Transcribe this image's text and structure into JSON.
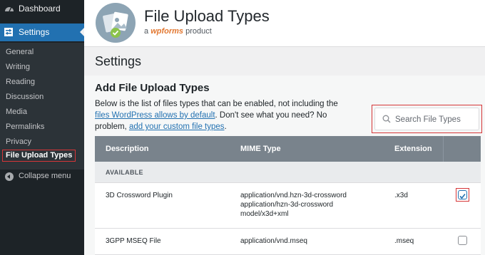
{
  "sidebar": {
    "dashboard_label": "Dashboard",
    "settings_label": "Settings",
    "submenu": [
      "General",
      "Writing",
      "Reading",
      "Discussion",
      "Media",
      "Permalinks",
      "Privacy",
      "File Upload Types"
    ],
    "collapse_label": "Collapse menu"
  },
  "header": {
    "title": "File Upload Types",
    "byline_prefix": "a",
    "brand": "wpforms",
    "byline_suffix": "product"
  },
  "page": {
    "title": "Settings"
  },
  "section": {
    "title": "Add File Upload Types",
    "desc_1": "Below is the list of files types that can be enabled, not including the ",
    "link_1": "files WordPress allows by default",
    "desc_2": ". Don't see what you need? No problem, ",
    "link_2": "add your custom file types",
    "desc_3": "."
  },
  "search": {
    "placeholder": "Search File Types"
  },
  "table": {
    "headers": [
      "Description",
      "MIME Type",
      "Extension"
    ],
    "group_label": "AVAILABLE",
    "rows": [
      {
        "description": "3D Crossword Plugin",
        "mime_1": "application/vnd.hzn-3d-crossword",
        "mime_2": "application/hzn-3d-crossword",
        "mime_3": "model/x3d+xml",
        "extension": ".x3d",
        "checked": true
      },
      {
        "description": "3GPP MSEQ File",
        "mime_1": "application/vnd.mseq",
        "extension": ".mseq",
        "checked": false
      }
    ]
  },
  "colors": {
    "accent": "#2271b1",
    "highlight": "#d63638",
    "sidebar_bg": "#1d2327",
    "brand": "#e27730"
  }
}
